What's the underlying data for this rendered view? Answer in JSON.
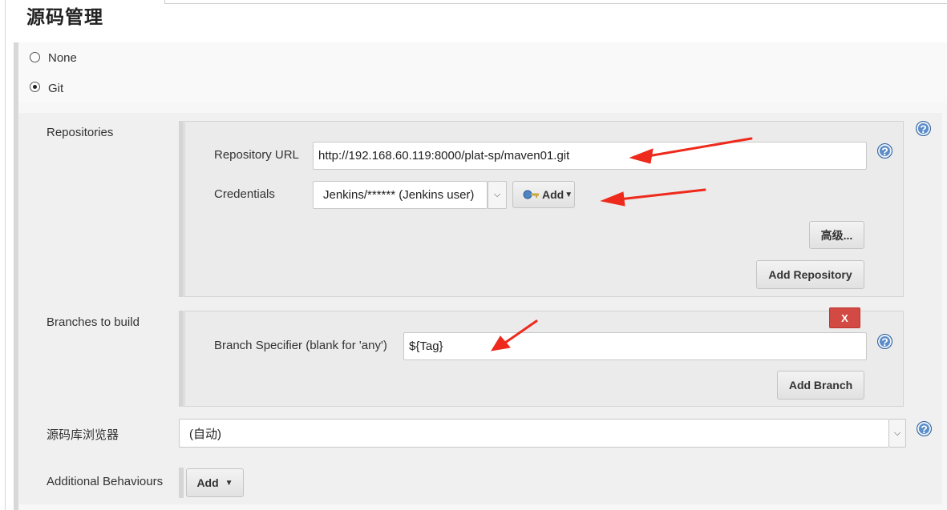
{
  "section": {
    "title": "源码管理"
  },
  "scm_options": [
    {
      "label": "None",
      "selected": false
    },
    {
      "label": "Git",
      "selected": true
    }
  ],
  "repositories": {
    "label": "Repositories",
    "url_label": "Repository URL",
    "url_value": "http://192.168.60.119:8000/plat-sp/maven01.git",
    "credentials_label": "Credentials",
    "credentials_value": "Jenkins/****** (Jenkins user)",
    "add_credentials_label": "Add",
    "advanced_label": "高级...",
    "add_repository_label": "Add Repository"
  },
  "branches": {
    "label": "Branches to build",
    "delete_label": "X",
    "specifier_label": "Branch Specifier (blank for 'any')",
    "specifier_value": "${Tag}",
    "add_branch_label": "Add Branch"
  },
  "browser": {
    "label": "源码库浏览器",
    "value": "(自动)"
  },
  "behaviours": {
    "label": "Additional Behaviours",
    "add_label": "Add"
  },
  "help_icon_text": "?",
  "colors": {
    "annotation_arrow": "#ee2a1c",
    "help_icon": "#5b8dc9",
    "delete_button": "#d24a43"
  }
}
